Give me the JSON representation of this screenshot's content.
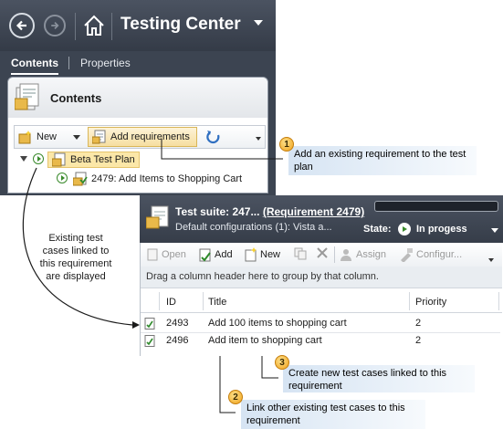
{
  "top_window": {
    "title": "Testing Center",
    "tabs": [
      {
        "label": "Contents",
        "active": true
      },
      {
        "label": "Properties",
        "active": false
      }
    ],
    "panel_title": "Contents",
    "toolbar": {
      "new_label": "New",
      "add_requirements_label": "Add requirements"
    },
    "tree": {
      "plan_label": "Beta Test Plan",
      "child_label": "2479: Add Items to Shopping Cart"
    }
  },
  "callouts": {
    "one": {
      "number": "1",
      "text": "Add an existing requirement to the test plan"
    },
    "two": {
      "number": "2",
      "text": "Link other existing test cases to this requirement"
    },
    "three": {
      "number": "3",
      "text": "Create new test cases linked to this requirement"
    },
    "side_note": "Existing test cases linked to this requirement are displayed"
  },
  "bottom_window": {
    "suite_prefix": "Test suite:  247...",
    "suite_link": "(Requirement 2479)",
    "config_text": "Default configurations (1): Vista a...",
    "state_label": "State:",
    "state_value": "In progess",
    "toolbar": {
      "open_label": "Open",
      "add_label": "Add",
      "new_label": "New",
      "assign_label": "Assign",
      "configure_label": "Configur..."
    },
    "group_hint": "Drag a column header here to group by that column.",
    "columns": [
      "ID",
      "Title",
      "Priority"
    ],
    "rows": [
      {
        "id": "2493",
        "title": "Add 100 items to shopping cart",
        "priority": "2"
      },
      {
        "id": "2496",
        "title": "Add item to shopping cart",
        "priority": "2"
      }
    ]
  },
  "colors": {
    "dark_chrome": "#3c4451",
    "highlight": "#fbe7a8",
    "callout": "#d6e4f3",
    "badge": "#f0a21b"
  }
}
